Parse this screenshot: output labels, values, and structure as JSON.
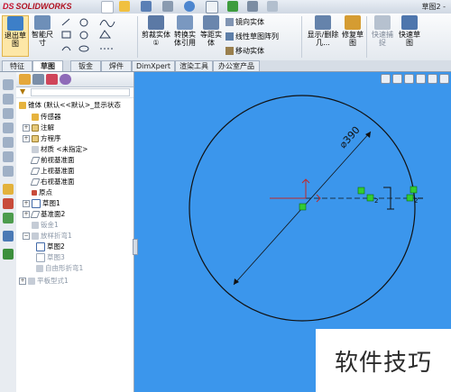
{
  "titlebar": {
    "brand_prefix": "DS",
    "brand": "SOLIDWORKS",
    "document_title": "草图2 -"
  },
  "ribbon": {
    "exit_sketch": "退出草图",
    "smart_dimension": "智能尺寸",
    "trim_entities": "剪裁实体①",
    "convert_entities": "转换实体引用",
    "offset_entities": "等距实体",
    "mirror_entities": "镜向实体",
    "linear_pattern": "线性草图阵列",
    "move_entities": "移动实体",
    "display_relations": "显示/删除几...",
    "repair_sketch": "修复草图",
    "quick_snaps": "快速捕捉",
    "rapid_sketch": "快速草图"
  },
  "tabs": [
    "特征",
    "草图",
    "钣金",
    "焊件",
    "DimXpert",
    "渲染工具",
    "办公室产品"
  ],
  "active_tab": "草图",
  "tree": {
    "root": "锥体 (默认<<默认>_显示状态",
    "items": [
      {
        "label": "传感器",
        "dim": false
      },
      {
        "label": "注解",
        "dim": false
      },
      {
        "label": "方程序",
        "dim": false
      },
      {
        "label": "材质 <未指定>",
        "dim": false
      },
      {
        "label": "前视基准面",
        "dim": false
      },
      {
        "label": "上视基准面",
        "dim": false
      },
      {
        "label": "右视基准面",
        "dim": false
      },
      {
        "label": "原点",
        "dim": false
      },
      {
        "label": "草图1",
        "dim": false
      },
      {
        "label": "基准面2",
        "dim": false
      },
      {
        "label": "钣金1",
        "dim": true
      },
      {
        "label": "放样折弯1",
        "dim": true
      },
      {
        "label": "草图2",
        "dim": false
      },
      {
        "label": "草图3",
        "dim": true
      },
      {
        "label": "自由形折弯1",
        "dim": true
      },
      {
        "label": "平板型式1",
        "dim": true
      }
    ]
  },
  "sketch": {
    "dimension_label": "⌀390",
    "relation_label": "2",
    "colors": {
      "background": "#3b96ec",
      "geometry": "#111111",
      "relation": "#33cc33",
      "origin": "#d03030"
    }
  },
  "watermark": "软件技巧"
}
